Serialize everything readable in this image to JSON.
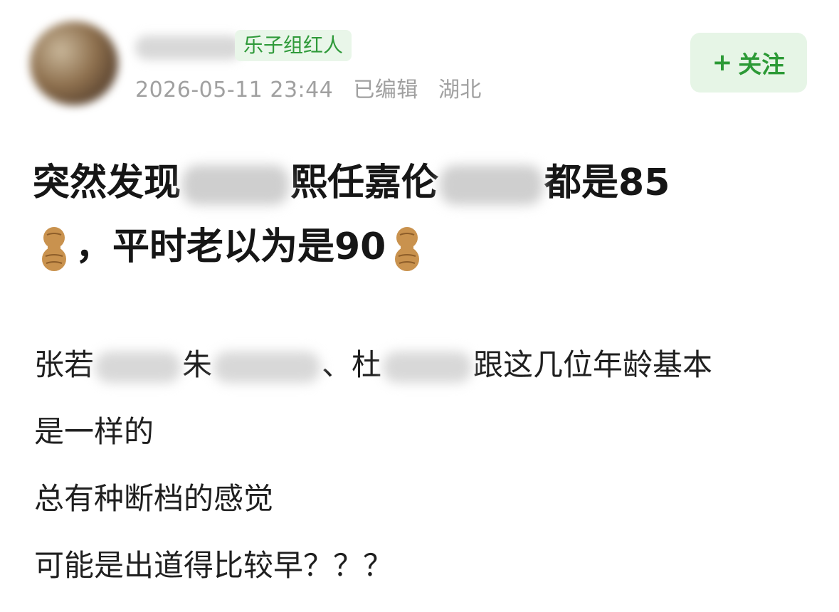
{
  "post": {
    "badge": "乐子组红人",
    "timestamp": "2026-05-11 23:44",
    "edited_label": "已编辑",
    "location": "湖北",
    "follow_label": "关注",
    "title": {
      "part1": "突然发现",
      "part2": "熙任嘉伦",
      "part3": "都是85",
      "part4": "，平时老以为是90"
    },
    "body": {
      "line1_a": "张若",
      "line1_b": "朱",
      "line1_c": "、杜",
      "line1_d": "跟这几位年龄基本",
      "line2": "是一样的",
      "line3": "总有种断档的感觉",
      "line4": "可能是出道得比较早？？？"
    },
    "icons": {
      "plus": "plus-icon",
      "peanut": "peanut-emoji-icon"
    },
    "colors": {
      "accent_green": "#2c9a36",
      "badge_bg": "#e9f6e9",
      "follow_bg": "#e6f5e6",
      "meta_gray": "#a0a0a0"
    }
  }
}
